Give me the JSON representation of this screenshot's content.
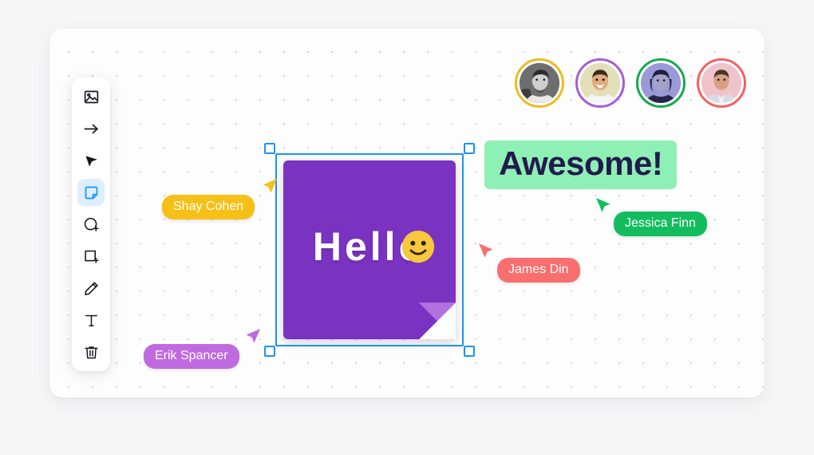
{
  "app": {
    "canvas_background": "#fdfdfd",
    "page_background": "#f7f7f8",
    "grid": "dot-grid"
  },
  "toolbar": {
    "name": "whiteboard-tools",
    "active_tool": "sticky-note",
    "items": [
      {
        "id": "image",
        "icon": "image-icon",
        "label": "Image",
        "active": false
      },
      {
        "id": "arrow",
        "icon": "arrow-right-icon",
        "label": "Arrow",
        "active": false
      },
      {
        "id": "select",
        "icon": "pointer-icon",
        "label": "Select",
        "active": false
      },
      {
        "id": "sticky-note",
        "icon": "sticky-note-icon",
        "label": "Sticky Note",
        "active": true
      },
      {
        "id": "circle",
        "icon": "circle-plus-icon",
        "label": "Circle",
        "active": false
      },
      {
        "id": "rectangle",
        "icon": "square-plus-icon",
        "label": "Rectangle",
        "active": false
      },
      {
        "id": "pencil",
        "icon": "pencil-icon",
        "label": "Pencil",
        "active": false
      },
      {
        "id": "text",
        "icon": "text-icon",
        "label": "Text",
        "active": false
      },
      {
        "id": "delete",
        "icon": "trash-icon",
        "label": "Delete",
        "active": false
      }
    ]
  },
  "avatars": [
    {
      "id": "avatar-1",
      "ring_color": "#efbb21",
      "photo_bg": "#5a5a5a",
      "skin": "#cfcfcf",
      "hair": "#2a2a2a",
      "shirt": "#e8e8e8",
      "grayscale": true
    },
    {
      "id": "avatar-2",
      "ring_color": "#a65ed6",
      "photo_bg": "#e3dfb8",
      "skin": "#e2a97e",
      "hair": "#3b2a1e",
      "shirt": "#f4f4f4",
      "grayscale": false
    },
    {
      "id": "avatar-3",
      "ring_color": "#15ab4c",
      "photo_bg": "#9a9ad8",
      "skin": "#a7a1c9",
      "hair": "#1d2040",
      "shirt": "#23264a",
      "grayscale": false
    },
    {
      "id": "avatar-4",
      "ring_color": "#f4615f",
      "photo_bg": "#f0c3cb",
      "skin": "#d8a083",
      "hair": "#4a3526",
      "shirt": "#d9dde3",
      "grayscale": false
    }
  ],
  "sticky_note": {
    "text": "Hello",
    "emoji": "slightly-smiling-face",
    "color": "#7a33c1",
    "fold_color": "#b46fe0",
    "selected": true,
    "selection_color": "#1a94f5"
  },
  "highlight_text": {
    "text": "Awesome!",
    "background": "#8ef0b4",
    "color": "#221a4e"
  },
  "collaborators": [
    {
      "name": "Shay Cohen",
      "color": "#f7c017",
      "arrow_direction": "up-right"
    },
    {
      "name": "James Din",
      "color": "#f96f6f",
      "arrow_direction": "up-left"
    },
    {
      "name": "Jessica Finn",
      "color": "#13bd5e",
      "arrow_direction": "up-left"
    },
    {
      "name": "Erik Spancer",
      "color": "#c06ae0",
      "arrow_direction": "up-right"
    }
  ]
}
